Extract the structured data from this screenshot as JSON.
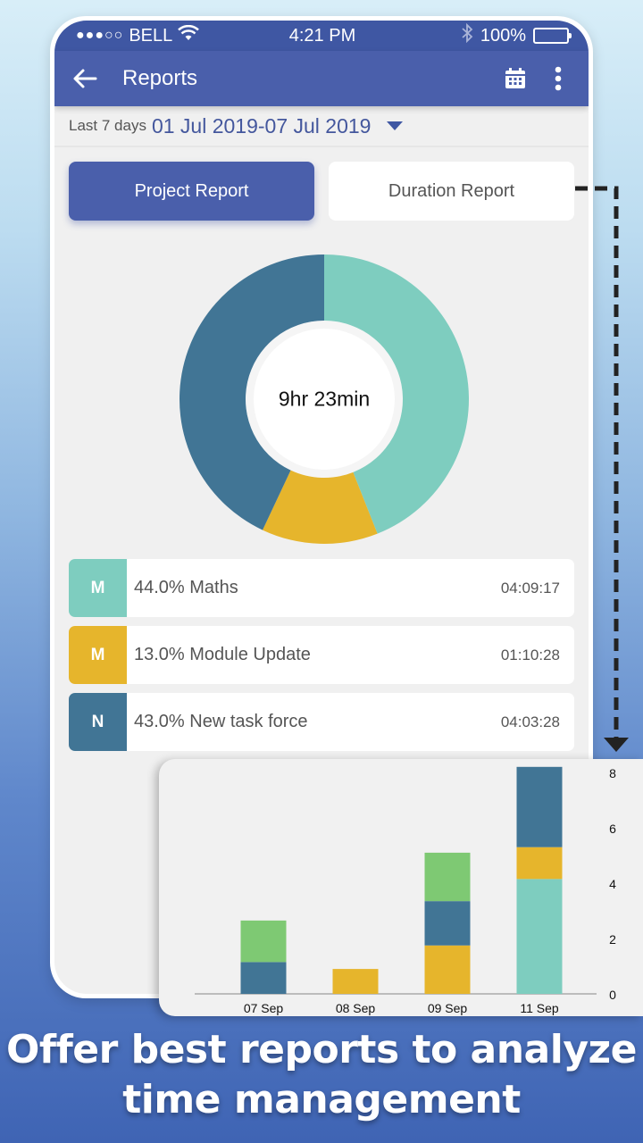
{
  "status_bar": {
    "carrier": "BELL",
    "signal_dots_filled": 3,
    "signal_dots_total": 5,
    "time": "4:21 PM",
    "battery": "100%"
  },
  "app_bar": {
    "title": "Reports",
    "back_icon": "arrow-left-icon",
    "calendar_icon": "calendar-icon",
    "more_icon": "more-vert-icon"
  },
  "date_filter": {
    "label": "Last 7 days",
    "range": "01 Jul 2019-07 Jul 2019"
  },
  "tabs": [
    {
      "label": "Project Report",
      "active": true
    },
    {
      "label": "Duration Report",
      "active": false
    }
  ],
  "donut": {
    "center_text": "9hr 23min"
  },
  "projects": [
    {
      "initial": "M",
      "percent_label": "44.0% Maths",
      "percent": 44.0,
      "duration": "04:09:17",
      "color": "#7ecdbf"
    },
    {
      "initial": "M",
      "percent_label": "13.0% Module Update",
      "percent": 13.0,
      "duration": "01:10:28",
      "color": "#e6b52c"
    },
    {
      "initial": "N",
      "percent_label": "43.0% New task force",
      "percent": 43.0,
      "duration": "04:03:28",
      "color": "#417595"
    }
  ],
  "tagline": {
    "line1": "Offer best reports to analyze",
    "line2": "time management"
  },
  "chart_data": [
    {
      "type": "pie",
      "title": "",
      "center_label": "9hr 23min",
      "labels": [
        "Maths",
        "Module Update",
        "New task force"
      ],
      "values": [
        44.0,
        13.0,
        43.0
      ],
      "colors": [
        "#7ecdbf",
        "#e6b52c",
        "#417595"
      ]
    },
    {
      "type": "bar",
      "stacked": true,
      "title": "",
      "xlabel": "",
      "ylabel": "",
      "categories": [
        "07 Sep",
        "08 Sep",
        "09 Sep",
        "11 Sep"
      ],
      "ylim": [
        0,
        8
      ],
      "yticks": [
        0,
        2,
        4,
        6,
        8
      ],
      "y_axis_side": "right",
      "series": [
        {
          "name": "teal",
          "color": "#7ecdbf",
          "values": [
            0,
            0,
            0,
            4.15
          ]
        },
        {
          "name": "yellow",
          "color": "#e6b52c",
          "values": [
            0,
            0.9,
            1.75,
            1.15
          ]
        },
        {
          "name": "blue",
          "color": "#417595",
          "values": [
            1.15,
            0,
            1.6,
            2.9
          ]
        },
        {
          "name": "green",
          "color": "#7ec973",
          "values": [
            1.5,
            0,
            1.75,
            0
          ]
        }
      ]
    }
  ]
}
